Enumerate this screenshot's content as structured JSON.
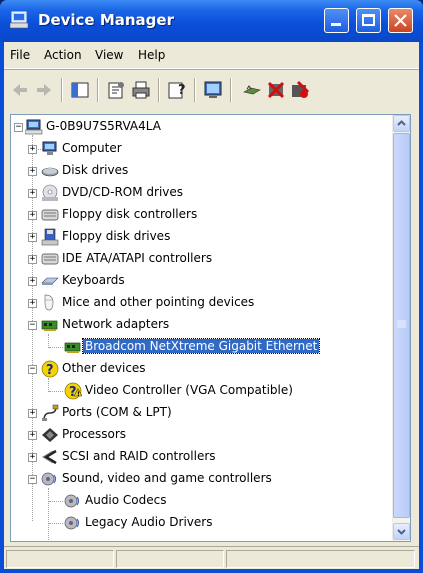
{
  "window": {
    "title": "Device Manager"
  },
  "menu": [
    "File",
    "Action",
    "View",
    "Help"
  ],
  "toolbar": [
    "back-icon",
    "forward-icon",
    "show-hide-console-tree-icon",
    "properties-icon",
    "print-icon",
    "help-icon",
    "scan-hardware-icon",
    "update-driver-icon",
    "uninstall-icon",
    "disable-icon"
  ],
  "tree": {
    "root": "G-0B9U7S5RVA4LA",
    "items": [
      {
        "label": "Computer",
        "icon": "computer-icon",
        "expanded": false
      },
      {
        "label": "Disk drives",
        "icon": "disk-drive-icon",
        "expanded": false
      },
      {
        "label": "DVD/CD-ROM drives",
        "icon": "cdrom-icon",
        "expanded": false
      },
      {
        "label": "Floppy disk controllers",
        "icon": "controller-icon",
        "expanded": false
      },
      {
        "label": "Floppy disk drives",
        "icon": "floppy-icon",
        "expanded": false
      },
      {
        "label": "IDE ATA/ATAPI controllers",
        "icon": "controller-icon",
        "expanded": false
      },
      {
        "label": "Keyboards",
        "icon": "keyboard-icon",
        "expanded": false
      },
      {
        "label": "Mice and other pointing devices",
        "icon": "mouse-icon",
        "expanded": false
      },
      {
        "label": "Network adapters",
        "icon": "network-card-icon",
        "expanded": true,
        "children": [
          {
            "label": "Broadcom NetXtreme Gigabit Ethernet",
            "icon": "network-card-icon",
            "selected": true
          }
        ]
      },
      {
        "label": "Other devices",
        "icon": "unknown-device-icon",
        "expanded": true,
        "children": [
          {
            "label": "Video Controller (VGA Compatible)",
            "icon": "unknown-device-icon"
          }
        ]
      },
      {
        "label": "Ports (COM & LPT)",
        "icon": "port-icon",
        "expanded": false
      },
      {
        "label": "Processors",
        "icon": "processor-icon",
        "expanded": false
      },
      {
        "label": "SCSI and RAID controllers",
        "icon": "scsi-icon",
        "expanded": false
      },
      {
        "label": "Sound, video and game controllers",
        "icon": "sound-icon",
        "expanded": true,
        "children": [
          {
            "label": "Audio Codecs",
            "icon": "sound-icon"
          },
          {
            "label": "Legacy Audio Drivers",
            "icon": "sound-icon"
          }
        ]
      }
    ]
  },
  "colors": {
    "titlebar": "#0a4ed8",
    "selection": "#316ac5",
    "frame": "#ece9d8"
  }
}
